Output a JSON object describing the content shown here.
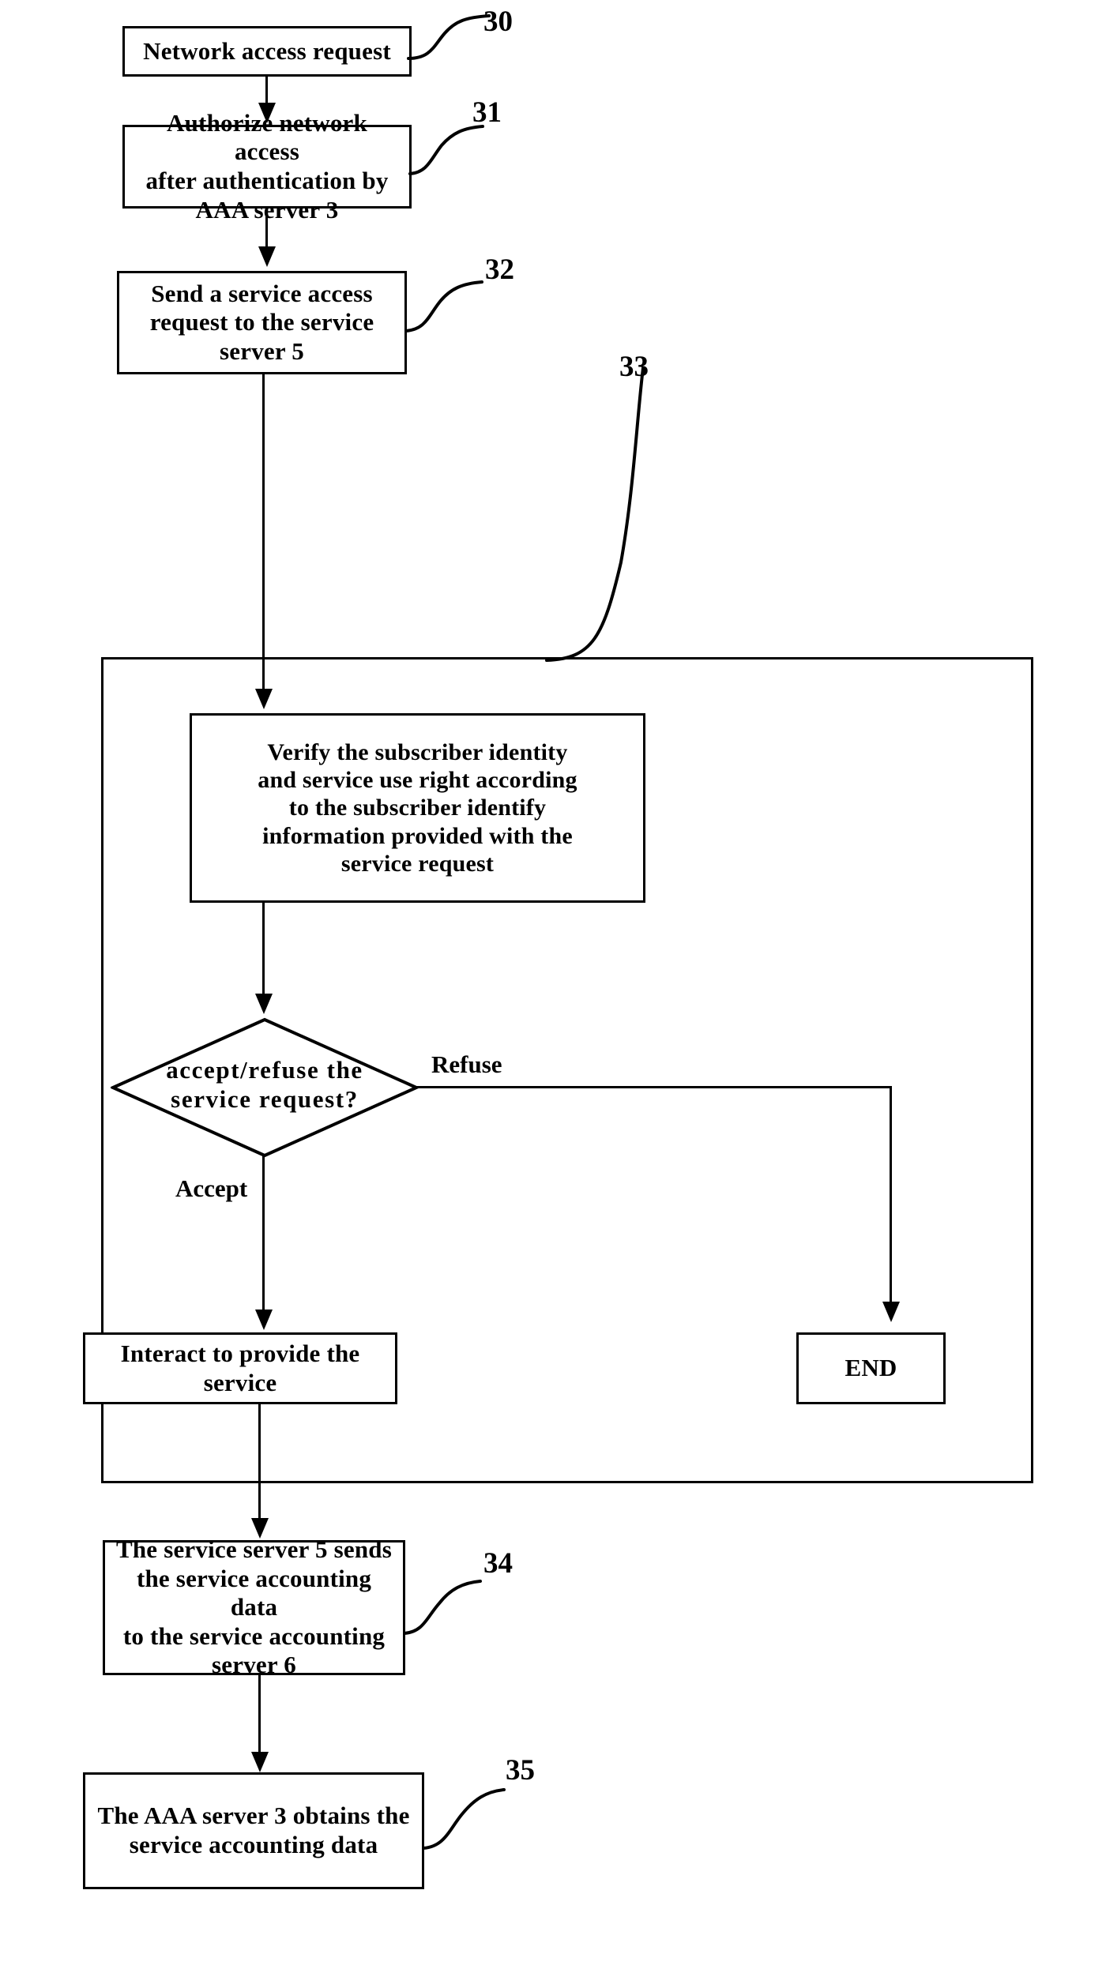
{
  "figure": {
    "type": "patent-flowchart",
    "background": "#ffffff",
    "ink": "#000000"
  },
  "nodes": {
    "n30": {
      "ref": "30",
      "shape": "process",
      "text": "Network access request"
    },
    "n31": {
      "ref": "31",
      "shape": "process",
      "text": "Authorize network access\nafter authentication by\nAAA server 3"
    },
    "n32": {
      "ref": "32",
      "shape": "process",
      "text": "Send a service access\nrequest to the service\nserver 5"
    },
    "n33": {
      "ref": "33",
      "shape": "group-container",
      "text": ""
    },
    "verify": {
      "shape": "process",
      "text": "Verify the subscriber identity\nand service use right according\nto the subscriber identify\ninformation provided with the\nservice request"
    },
    "decision": {
      "shape": "diamond",
      "text": "accept/refuse the\nservice request?"
    },
    "interact": {
      "shape": "process",
      "text": "Interact to provide the service"
    },
    "end": {
      "shape": "process",
      "text": "END"
    },
    "n34": {
      "ref": "34",
      "shape": "process",
      "text": "The service server 5 sends\nthe service accounting data\nto the service accounting\nserver 6"
    },
    "n35": {
      "ref": "35",
      "shape": "process",
      "text": "The AAA server 3 obtains the\nservice accounting data"
    }
  },
  "edge_labels": {
    "refuse": "Refuse",
    "accept": "Accept"
  },
  "reference_numerals": [
    "30",
    "31",
    "32",
    "33",
    "34",
    "35"
  ],
  "flow": [
    {
      "from": "n30",
      "to": "n31"
    },
    {
      "from": "n31",
      "to": "n32"
    },
    {
      "from": "n32",
      "to": "verify"
    },
    {
      "from": "verify",
      "to": "decision"
    },
    {
      "from": "decision",
      "to": "interact",
      "label": "Accept"
    },
    {
      "from": "decision",
      "to": "end",
      "label": "Refuse"
    },
    {
      "from": "interact",
      "to": "n34"
    },
    {
      "from": "n34",
      "to": "n35"
    }
  ]
}
